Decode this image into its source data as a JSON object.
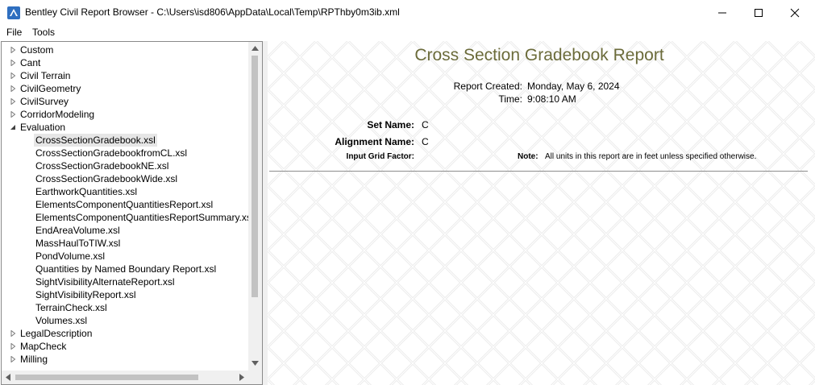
{
  "window": {
    "title": "Bentley Civil Report Browser - C:\\Users\\isd806\\AppData\\Local\\Temp\\RPThby0m3ib.xml",
    "icon": "bentley-app-icon",
    "controls": [
      "minimize-icon",
      "maximize-icon",
      "close-icon"
    ]
  },
  "menu": [
    "File",
    "Tools"
  ],
  "tree": {
    "top_nodes_before": [
      "Custom",
      "Cant",
      "Civil Terrain",
      "CivilGeometry",
      "CivilSurvey",
      "CorridorModeling"
    ],
    "expanded_node": "Evaluation",
    "children": [
      "CrossSectionGradebook.xsl",
      "CrossSectionGradebookfromCL.xsl",
      "CrossSectionGradebookNE.xsl",
      "CrossSectionGradebookWide.xsl",
      "EarthworkQuantities.xsl",
      "ElementsComponentQuantitiesReport.xsl",
      "ElementsComponentQuantitiesReportSummary.xs",
      "EndAreaVolume.xsl",
      "MassHaulToTIW.xsl",
      "PondVolume.xsl",
      "Quantities by Named Boundary Report.xsl",
      "SightVisibilityAlternateReport.xsl",
      "SightVisibilityReport.xsl",
      "TerrainCheck.xsl",
      "Volumes.xsl"
    ],
    "selected": "CrossSectionGradebook.xsl",
    "top_nodes_after": [
      "LegalDescription",
      "MapCheck",
      "Milling"
    ]
  },
  "report": {
    "title": "Cross Section Gradebook Report",
    "created_label": "Report Created:",
    "created_value": "Monday, May 6, 2024",
    "time_label": "Time:",
    "time_value": "9:08:10 AM",
    "set_name_label": "Set Name:",
    "set_name_value": "C",
    "alignment_label": "Alignment Name:",
    "alignment_value": "C",
    "grid_factor_label": "Input Grid Factor:",
    "note_label": "Note:",
    "note_text": "All units in this report are in feet unless specified otherwise.",
    "title_color": "#6b6b3a"
  }
}
